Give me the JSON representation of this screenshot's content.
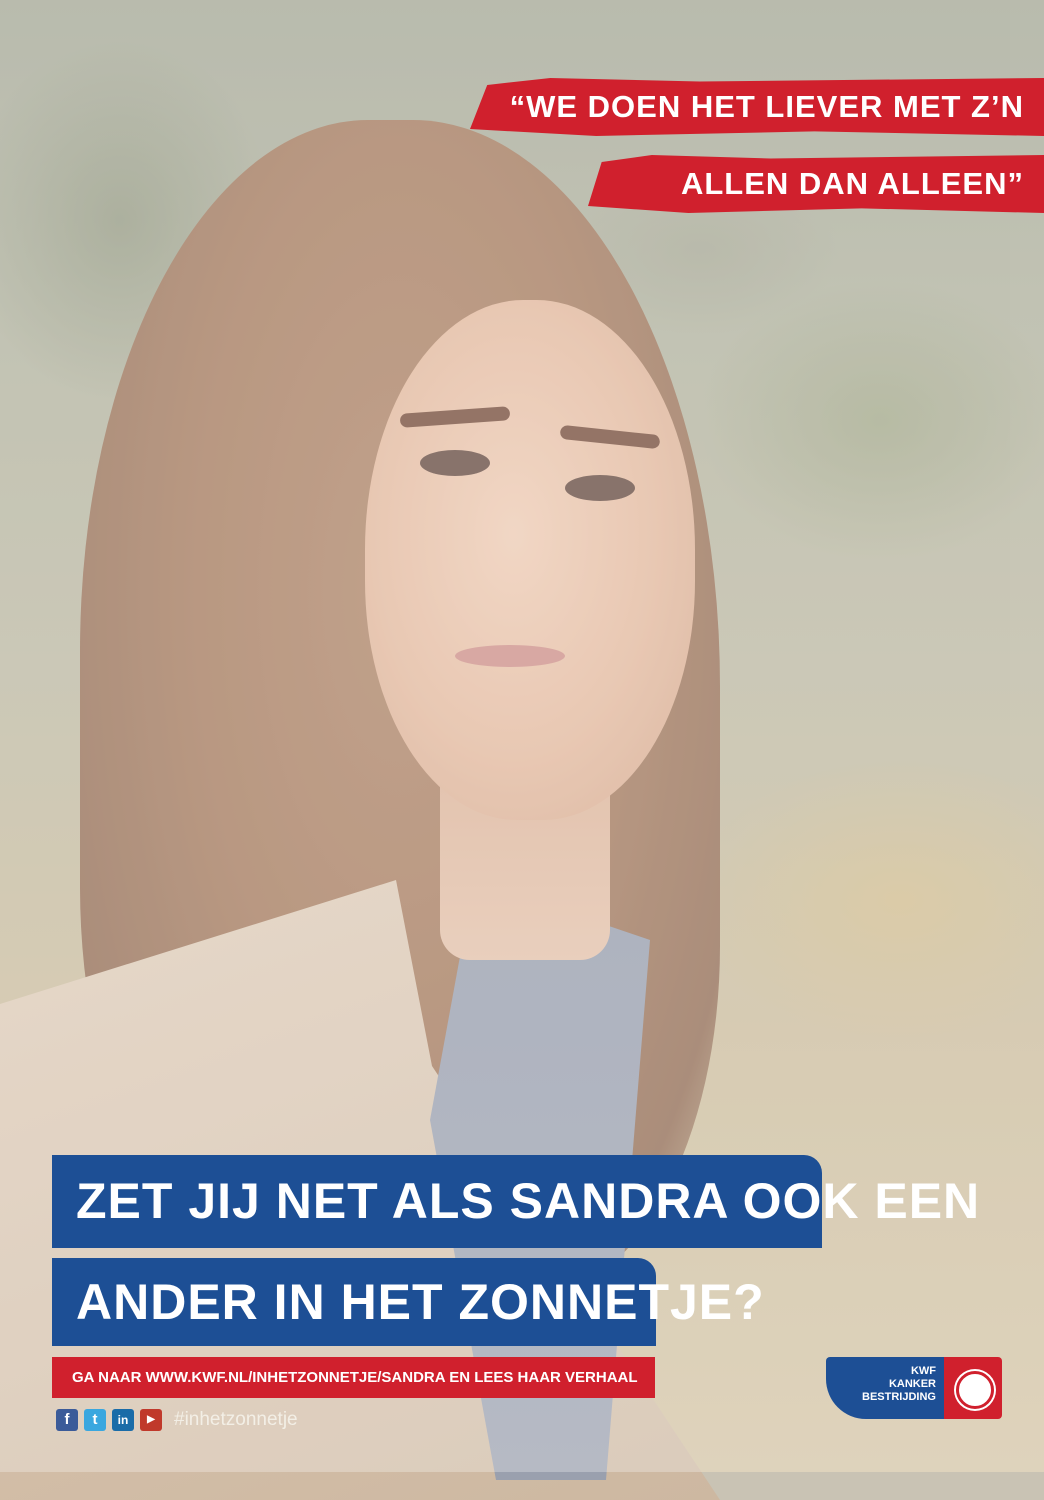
{
  "quote": {
    "line1": "“We doen het liever met z’n",
    "line2": "allen dan alleen”"
  },
  "headline": {
    "line1": "Zet jij net als Sandra ook een",
    "line2": "ander in het zonnetje?"
  },
  "cta": "GA NAAR WWW.KWF.NL/INHETZONNETJE/SANDRA EN LEES HAAR VERHAAL",
  "social": {
    "icons": [
      "facebook-icon",
      "twitter-icon",
      "linkedin-icon",
      "youtube-icon"
    ],
    "hashtag": "#inhetzonnetje"
  },
  "logo": {
    "lines": [
      "KWF",
      "KANKER",
      "BESTRIJDING"
    ],
    "colors": {
      "blue": "#1d4f95",
      "red": "#d0202d"
    }
  }
}
